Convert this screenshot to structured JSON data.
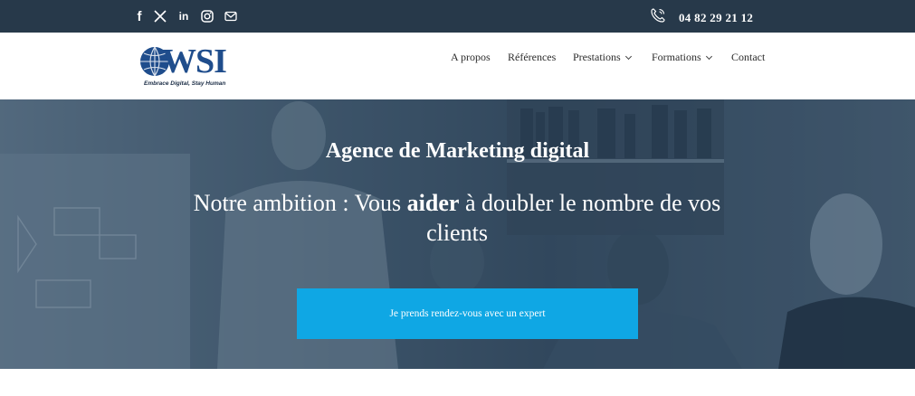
{
  "topbar": {
    "social_icons": [
      "facebook-icon",
      "x-twitter-icon",
      "linkedin-icon",
      "instagram-icon",
      "email-icon"
    ],
    "facebook_glyph": "f",
    "x_glyph": "𝕏",
    "linkedin_glyph": "in",
    "phone_icon": "phone-icon",
    "phone_number": "04 82 29 21 12"
  },
  "header": {
    "logo": {
      "text": "WSI",
      "tagline": "Embrace Digital, Stay Human"
    },
    "nav": [
      {
        "label": "A propos",
        "dropdown": false
      },
      {
        "label": "Références",
        "dropdown": false
      },
      {
        "label": "Prestations",
        "dropdown": true
      },
      {
        "label": "Formations",
        "dropdown": true
      },
      {
        "label": "Contact",
        "dropdown": false
      }
    ]
  },
  "hero": {
    "title": "Agence de Marketing digital",
    "subtitle_before": "Notre ambition : Vous ",
    "subtitle_bold": "aider",
    "subtitle_after": " à doubler le nombre de vos clients",
    "cta_label": "Je prends rendez-vous avec un expert"
  },
  "colors": {
    "topbar_bg": "#27394a",
    "logo_blue": "#1f4d8c",
    "cta_bg": "#0fa7e4"
  }
}
